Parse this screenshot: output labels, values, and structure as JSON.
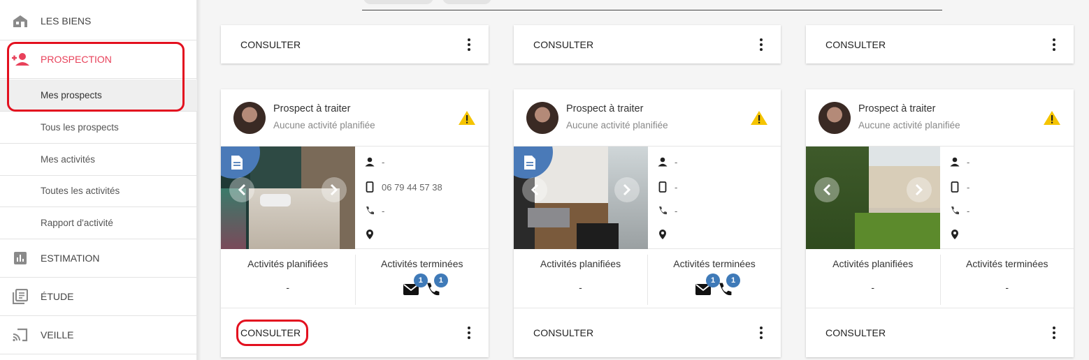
{
  "sidebar": {
    "items": [
      {
        "label": "LES BIENS",
        "icon": "building-icon"
      },
      {
        "label": "PROSPECTION",
        "icon": "add-person-icon",
        "active": true
      },
      {
        "label": "Mes prospects",
        "selected": true
      },
      {
        "label": "Tous les prospects"
      },
      {
        "label": "Mes activités"
      },
      {
        "label": "Toutes les activités"
      },
      {
        "label": "Rapport d'activité"
      },
      {
        "label": "ESTIMATION",
        "icon": "bar-chart-icon"
      },
      {
        "label": "ÉTUDE",
        "icon": "library-icon"
      },
      {
        "label": "VEILLE",
        "icon": "cast-icon"
      }
    ]
  },
  "top_cards": [
    {
      "action": "CONSULTER"
    },
    {
      "action": "CONSULTER"
    },
    {
      "action": "CONSULTER"
    }
  ],
  "prospects": [
    {
      "title": "Prospect à traiter",
      "subtitle": "Aucune activité planifiée",
      "person": "-",
      "mobile": "06 79 44 57 38",
      "phone": "-",
      "planned_label": "Activités planifiées",
      "planned_value": "-",
      "done_label": "Activités terminées",
      "done_email_count": "1",
      "done_call_count": "1",
      "action": "CONSULTER"
    },
    {
      "title": "Prospect à traiter",
      "subtitle": "Aucune activité planifiée",
      "person": "-",
      "mobile": "-",
      "phone": "-",
      "planned_label": "Activités planifiées",
      "planned_value": "-",
      "done_label": "Activités terminées",
      "done_email_count": "1",
      "done_call_count": "1",
      "action": "CONSULTER"
    },
    {
      "title": "Prospect à traiter",
      "subtitle": "Aucune activité planifiée",
      "person": "-",
      "mobile": "-",
      "phone": "-",
      "planned_label": "Activités planifiées",
      "planned_value": "-",
      "done_label": "Activités terminées",
      "done_value": "-",
      "action": "CONSULTER"
    }
  ],
  "colors": {
    "accent": "#e8415a",
    "badge": "#3f7ab8",
    "warning": "#f5c400",
    "annotation": "#e3101f"
  }
}
